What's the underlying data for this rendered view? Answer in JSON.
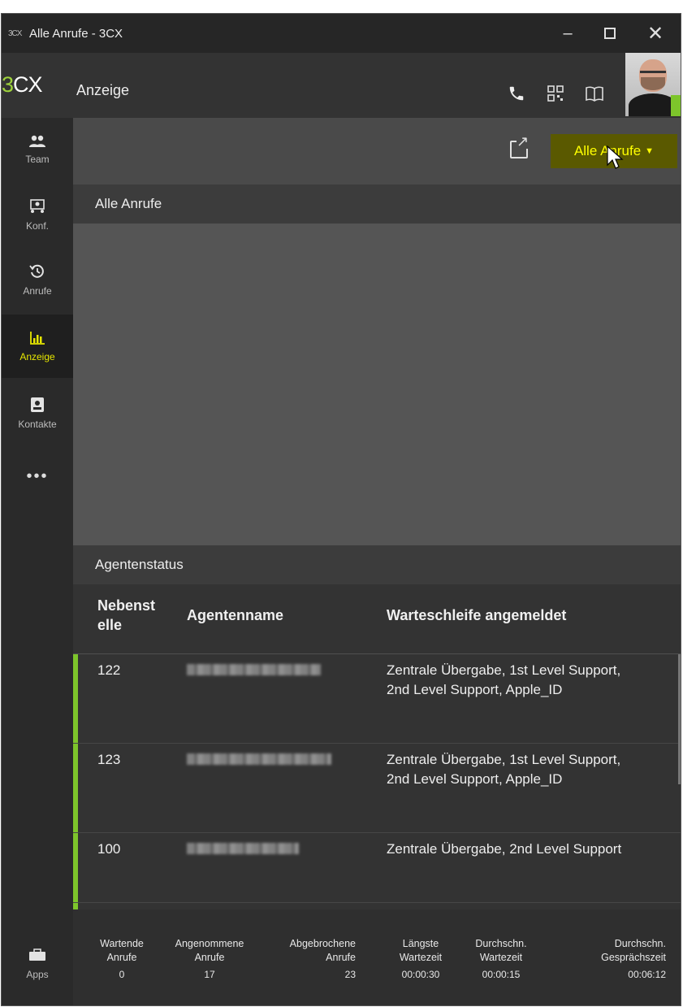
{
  "window": {
    "app_icon": "3CX",
    "title": "Alle Anrufe - 3CX",
    "controls": {
      "minimize": "–",
      "maximize": "",
      "close": "✕"
    }
  },
  "header": {
    "brand": "3CX",
    "page_title": "Anzeige",
    "icons": [
      "phone-icon",
      "qr-code-icon",
      "book-icon"
    ]
  },
  "sidebar": {
    "items": [
      {
        "label": "Team",
        "icon": "team-icon",
        "glyph": "👥",
        "active": false
      },
      {
        "label": "Konf.",
        "icon": "conference-icon",
        "glyph": "⊞",
        "active": false
      },
      {
        "label": "Anrufe",
        "icon": "history-icon",
        "glyph": "↺",
        "active": false
      },
      {
        "label": "Anzeige",
        "icon": "bar-chart-icon",
        "glyph": "📊",
        "active": true
      },
      {
        "label": "Kontakte",
        "icon": "contacts-icon",
        "glyph": "▣",
        "active": false
      }
    ],
    "more": "•••",
    "apps_label": "Apps"
  },
  "toolbar": {
    "filter_button": "Alle Anrufe",
    "accent_color": "#ffff00"
  },
  "calls_section": {
    "title": "Alle Anrufe"
  },
  "agents_section": {
    "title": "Agentenstatus",
    "columns": [
      "Nebenst elle",
      "Agentenname",
      "Warteschleife angemeldet"
    ],
    "rows": [
      {
        "extension": "122",
        "queues": "Zentrale Übergabe, 1st Level Support, 2nd Level Support, Apple_ID"
      },
      {
        "extension": "123",
        "queues": "Zentrale Übergabe, 1st Level Support, 2nd Level Support, Apple_ID"
      },
      {
        "extension": "100",
        "queues": "Zentrale Übergabe, 2nd Level Support"
      }
    ],
    "status_color": "#7dc52b"
  },
  "stats": [
    {
      "label": "Wartende Anrufe",
      "value": "0"
    },
    {
      "label": "Angenommene Anrufe",
      "value": "17"
    },
    {
      "label": "Abgebrochene Anrufe",
      "value": "23"
    },
    {
      "label": "Längste Wartezeit",
      "value": "00:00:30"
    },
    {
      "label": "Durchschn. Wartezeit",
      "value": "00:00:15"
    },
    {
      "label": "Durchschn. Gesprächszeit",
      "value": "00:06:12"
    }
  ]
}
